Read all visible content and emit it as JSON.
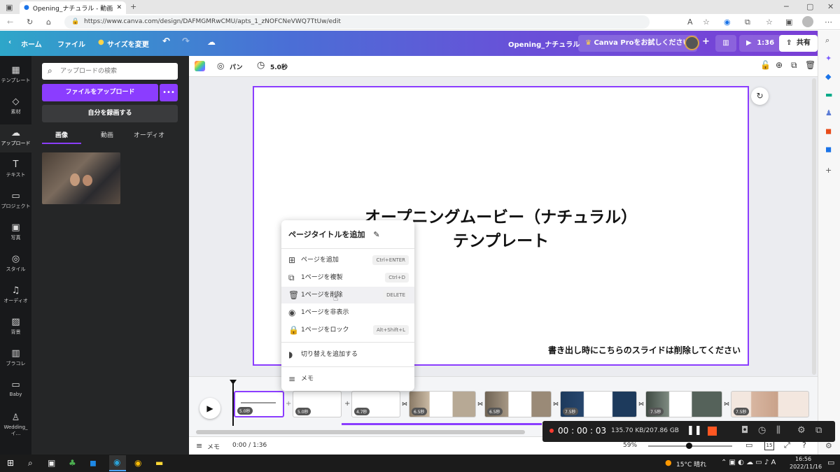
{
  "browser": {
    "tab_title": "Opening_ナチュラル - 動画",
    "url": "https://www.canva.com/design/DAFMGMRwCMU/apts_1_zNOFCNeVWQ7TtUw/edit"
  },
  "header": {
    "home": "ホーム",
    "file": "ファイル",
    "resize": "サイズを変更",
    "doc_title": "Opening_ナチュラル",
    "pro": "Canva Proをお試しください",
    "play_time": "1:36",
    "share": "共有"
  },
  "rail": [
    {
      "label": "テンプレート",
      "glyph": "▦"
    },
    {
      "label": "素材",
      "glyph": "◇"
    },
    {
      "label": "アップロード",
      "glyph": "☁"
    },
    {
      "label": "テキスト",
      "glyph": "T"
    },
    {
      "label": "プロジェクト",
      "glyph": "▭"
    },
    {
      "label": "写真",
      "glyph": "▣"
    },
    {
      "label": "スタイル",
      "glyph": "◎"
    },
    {
      "label": "オーディオ",
      "glyph": "♫"
    },
    {
      "label": "背景",
      "glyph": "▨"
    },
    {
      "label": "ブラコレ",
      "glyph": "▥"
    },
    {
      "label": "Baby",
      "glyph": "▭"
    },
    {
      "label": "Wedding_イ...",
      "glyph": "♙"
    }
  ],
  "panel": {
    "search_placeholder": "アップロードの検索",
    "upload_button": "ファイルをアップロード",
    "record_button": "自分を録画する",
    "tabs": [
      "画像",
      "動画",
      "オーディオ"
    ]
  },
  "toolbar": {
    "pan": "パン",
    "duration": "5.0秒"
  },
  "slide": {
    "title_line1": "オープニングムービー（ナチュラル）",
    "title_line2": "テンプレート",
    "note": "書き出し時にこちらのスライドは削除してください"
  },
  "context_menu": {
    "header": "ページタイトルを追加",
    "items": [
      {
        "label": "ページを追加",
        "shortcut": "Ctrl+ENTER",
        "glyph": "⊞"
      },
      {
        "label": "1ページを複製",
        "shortcut": "Ctrl+D",
        "glyph": "⧉"
      },
      {
        "label": "1ページを削除",
        "shortcut": "DELETE",
        "glyph": "🗑"
      },
      {
        "label": "1ページを非表示",
        "shortcut": "",
        "glyph": "◉"
      },
      {
        "label": "1ページをロック",
        "shortcut": "Alt+Shift+L",
        "glyph": "🔒"
      },
      {
        "label": "切り替えを追加する",
        "shortcut": "",
        "glyph": "◗"
      },
      {
        "label": "メモ",
        "shortcut": "",
        "glyph": "≡"
      }
    ]
  },
  "timeline": {
    "durations": [
      "5.0秒",
      "5.0秒",
      "4.7秒",
      "6.5秒",
      "6.5秒",
      "7.5秒",
      "7.5秒",
      "7.5秒"
    ]
  },
  "bottombar": {
    "memo": "メモ",
    "time": "0:00 / 1:36",
    "zoom": "59%",
    "page_count": "15"
  },
  "recorder": {
    "elapsed": "00 : 00 : 03",
    "size": "135.70 KB/207.86 GB"
  },
  "taskbar": {
    "weather": "15°C 晴れ",
    "time": "16:56",
    "date": "2022/11/16"
  },
  "colors": {
    "accent_purple": "#8b3dff",
    "rail_bg": "#18191b",
    "panel_bg": "#252627"
  }
}
